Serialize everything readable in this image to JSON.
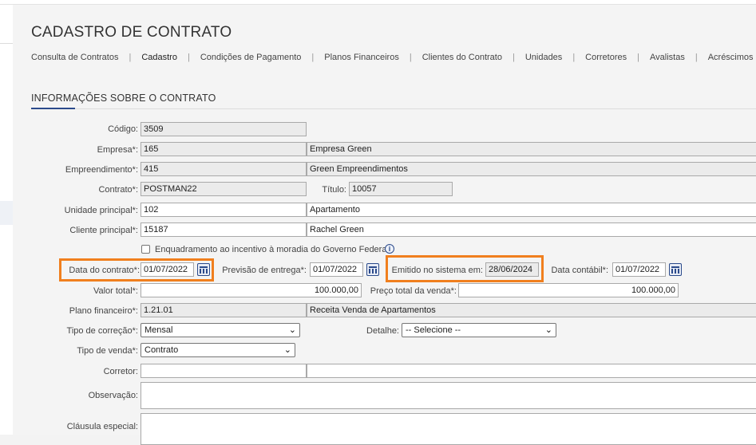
{
  "page": {
    "title": "CADASTRO DE CONTRATO"
  },
  "tabs": [
    {
      "label": "Consulta de Contratos"
    },
    {
      "label": "Cadastro"
    },
    {
      "label": "Condições de Pagamento"
    },
    {
      "label": "Planos Financeiros"
    },
    {
      "label": "Clientes do Contrato"
    },
    {
      "label": "Unidades"
    },
    {
      "label": "Corretores"
    },
    {
      "label": "Avalistas"
    },
    {
      "label": "Acréscimos"
    }
  ],
  "section": {
    "title": "INFORMAÇÕES SOBRE O CONTRATO"
  },
  "form": {
    "codigo": {
      "label": "Código:",
      "value": "3509"
    },
    "empresa": {
      "label": "Empresa*:",
      "code": "165",
      "name": "Empresa Green"
    },
    "empreendimento": {
      "label": "Empreendimento*:",
      "code": "415",
      "name": "Green Empreendimentos"
    },
    "contrato": {
      "label": "Contrato*:",
      "value": "POSTMAN22"
    },
    "titulo": {
      "label": "Título:",
      "value": "10057"
    },
    "unidade": {
      "label": "Unidade principal*:",
      "code": "102",
      "name": "Apartamento"
    },
    "cliente": {
      "label": "Cliente principal*:",
      "code": "15187",
      "name": "Rachel Green"
    },
    "enquadramento": {
      "label": "Enquadramento ao incentivo à moradia do Governo Federal",
      "info_icon": "info-icon"
    },
    "data_contrato": {
      "label": "Data do contrato*:",
      "value": "01/07/2022"
    },
    "previsao_entrega": {
      "label": "Previsão de entrega*:",
      "value": "01/07/2022"
    },
    "emitido_sistema": {
      "label": "Emitido no sistema em:",
      "value": "28/06/2024"
    },
    "data_contabil": {
      "label": "Data contábil*:",
      "value": "01/07/2022"
    },
    "valor_total": {
      "label": "Valor total*:",
      "value": "100.000,00"
    },
    "preco_total": {
      "label": "Preço total da venda*:",
      "value": "100.000,00"
    },
    "plano_financeiro": {
      "label": "Plano financeiro*:",
      "code": "1.21.01",
      "name": "Receita Venda de Apartamentos"
    },
    "tipo_correcao": {
      "label": "Tipo de correção*:",
      "value": "Mensal"
    },
    "detalhe": {
      "label": "Detalhe:",
      "value": "-- Selecione --"
    },
    "tipo_venda": {
      "label": "Tipo de venda*:",
      "value": "Contrato"
    },
    "corretor": {
      "label": "Corretor:",
      "code": "",
      "name": ""
    },
    "observacao": {
      "label": "Observação:",
      "value": ""
    },
    "clausula": {
      "label": "Cláusula especial:",
      "value": ""
    }
  },
  "colors": {
    "highlight": "#f07f1e",
    "accent": "#2b4a8b"
  }
}
